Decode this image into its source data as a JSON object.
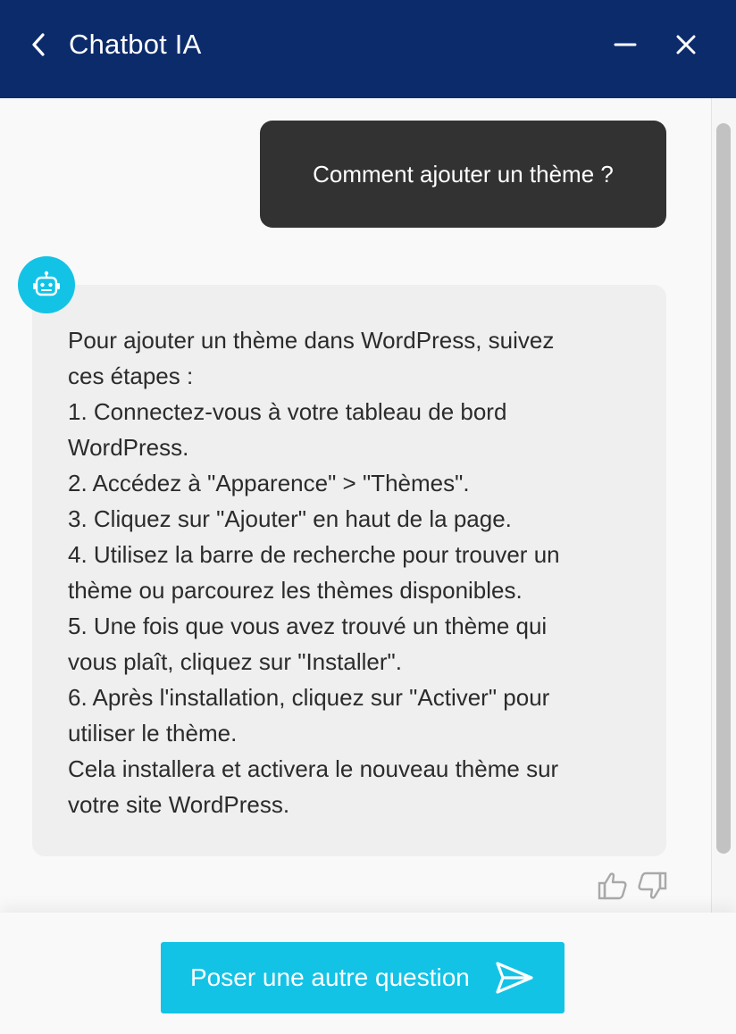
{
  "header": {
    "title": "Chatbot IA",
    "background": "#0c2b6b"
  },
  "conversation": {
    "user_message": "Comment ajouter un thème ?",
    "bot_message_lines": [
      "Pour ajouter un thème dans WordPress, suivez",
      "ces étapes :",
      "1. Connectez-vous à votre tableau de bord",
      "WordPress.",
      "2. Accédez à \"Apparence\" > \"Thèmes\".",
      "3. Cliquez sur \"Ajouter\" en haut de la page.",
      "4. Utilisez la barre de recherche pour trouver un",
      "thème ou parcourez les thèmes disponibles.",
      "5. Une fois que vous avez trouvé un thème qui",
      "vous plaît, cliquez sur \"Installer\".",
      "6. Après l'installation, cliquez sur \"Activer\" pour",
      "utiliser le thème.",
      "Cela installera et activera le nouveau thème sur",
      "votre site WordPress."
    ]
  },
  "icons": {
    "back": "chevron-left-icon",
    "minimize": "minus-icon",
    "close": "close-icon",
    "avatar": "robot-icon",
    "thumb_up": "thumbs-up-icon",
    "thumb_down": "thumbs-down-icon",
    "send": "send-icon"
  },
  "footer": {
    "ask_button_label": "Poser une autre question",
    "accent": "#13c3e6"
  }
}
